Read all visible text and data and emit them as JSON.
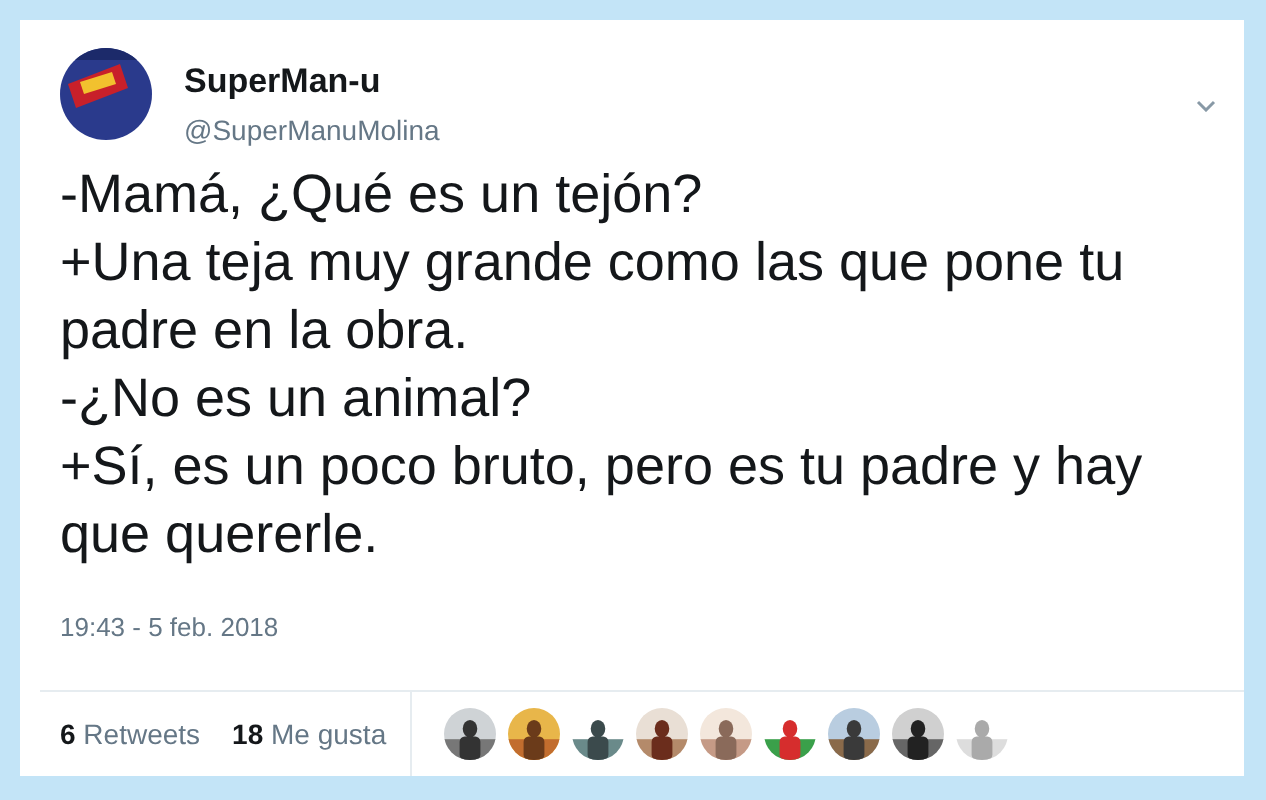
{
  "author": {
    "name": "SuperMan-u",
    "handle": "@SuperManuMolina"
  },
  "tweet_lines": [
    "-Mamá, ¿Qué es un tejón?",
    "+Una teja muy grande como las que pone tu padre en la obra.",
    "-¿No es un animal?",
    "+Sí, es un poco bruto, pero es tu padre y hay que quererle."
  ],
  "timestamp": "19:43 - 5 feb. 2018",
  "stats": [
    {
      "count": "6",
      "label": "Retweets"
    },
    {
      "count": "18",
      "label": "Me gusta"
    }
  ]
}
